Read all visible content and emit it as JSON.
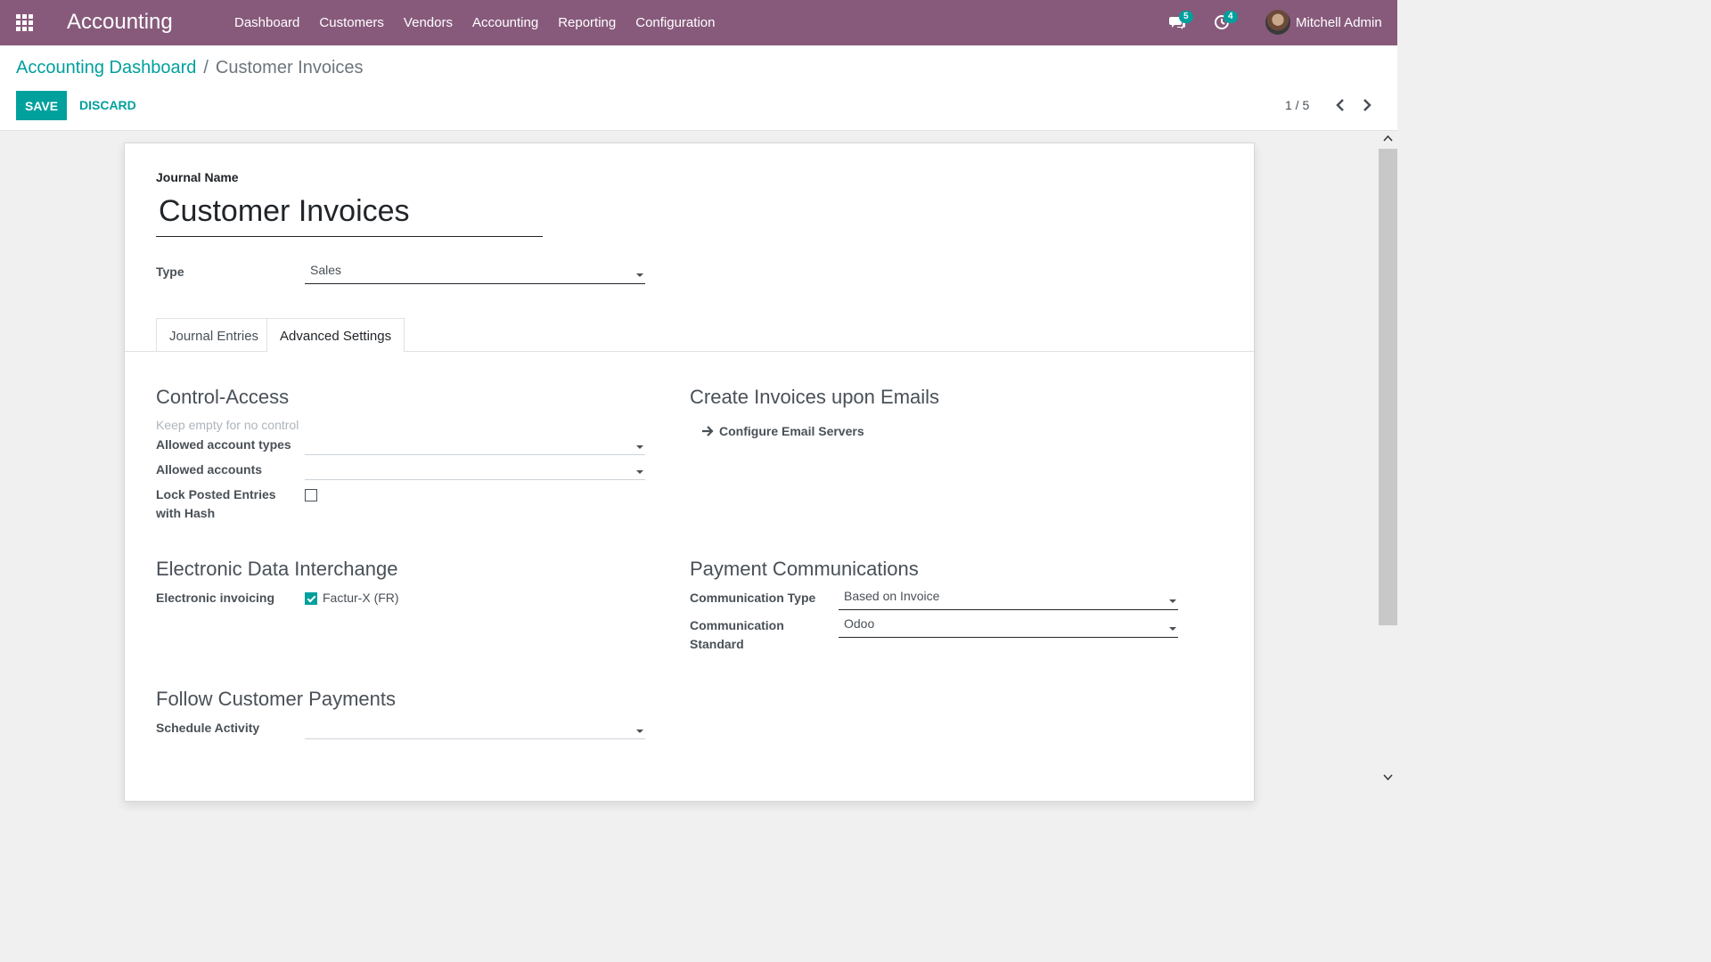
{
  "navbar": {
    "app_name": "Accounting",
    "menu": [
      "Dashboard",
      "Customers",
      "Vendors",
      "Accounting",
      "Reporting",
      "Configuration"
    ],
    "messages_count": "5",
    "activities_count": "4",
    "user_name": "Mitchell Admin",
    "icons": [
      "apps-grid-icon",
      "chat-icon",
      "clock-icon"
    ]
  },
  "breadcrumb": {
    "parent": "Accounting Dashboard",
    "separator": "/",
    "current": "Customer Invoices"
  },
  "actions": {
    "save_label": "SAVE",
    "discard_label": "DISCARD"
  },
  "pager": {
    "value": "1 / 5"
  },
  "form": {
    "journal_name_label": "Journal Name",
    "journal_name": "Customer Invoices",
    "type_label": "Type",
    "type_value": "Sales",
    "tabs": [
      "Journal Entries",
      "Advanced Settings"
    ],
    "active_tab": "Advanced Settings",
    "control_access": {
      "title": "Control-Access",
      "hint": "Keep empty for no control",
      "allowed_account_types_label": "Allowed account types",
      "allowed_account_types_value": "",
      "allowed_accounts_label": "Allowed accounts",
      "allowed_accounts_value": "",
      "lock_posted_label_line1": "Lock Posted Entries",
      "lock_posted_label_line2": "with Hash",
      "lock_posted_checked": false
    },
    "create_invoices": {
      "title": "Create Invoices upon Emails",
      "configure_link": "Configure Email Servers"
    },
    "edi": {
      "title": "Electronic Data Interchange",
      "electronic_invoicing_label": "Electronic invoicing",
      "option_label": "Factur-X (FR)",
      "option_checked": true
    },
    "payment_comm": {
      "title": "Payment Communications",
      "comm_type_label": "Communication Type",
      "comm_type_value": "Based on Invoice",
      "comm_standard_label_line1": "Communication",
      "comm_standard_label_line2": "Standard",
      "comm_standard_value": "Odoo"
    },
    "follow_payments": {
      "title": "Follow Customer Payments",
      "schedule_activity_label": "Schedule Activity",
      "schedule_activity_value": ""
    }
  },
  "colors": {
    "navbar": "#875a7b",
    "accent": "#00a09d"
  }
}
